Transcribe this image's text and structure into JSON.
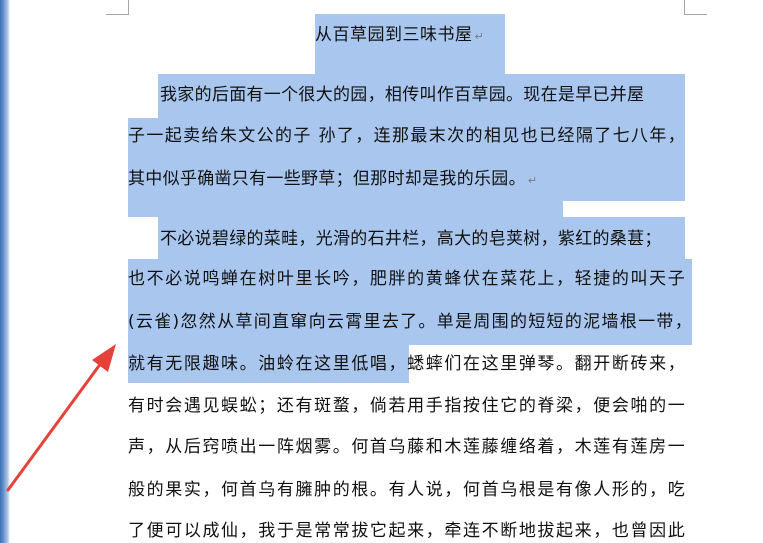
{
  "document": {
    "title": "从百草园到三味书屋",
    "paragraph_mark": "↵",
    "lines": [
      "我家的后面有一个很大的园，相传叫作百草园。现在是早已并屋",
      "子一起卖给朱文公的子 孙了，连那最末次的相见也已经隔了七八年，",
      "其中似乎确凿只有一些野草；但那时却是我的乐园。",
      "不必说碧绿的菜畦，光滑的石井栏，高大的皂荚树，紫红的桑葚；",
      "也不必说鸣蝉在树叶里长吟，肥胖的黄蜂伏在菜花上，轻捷的叫天子",
      "(云雀)忽然从草间直窜向云霄里去了。单是周围的短短的泥墙根一带，",
      "就有无限趣味。油蛉在这里低唱，蟋蟀们在这里弹琴。翻开断砖来，",
      "有时会遇见蜈蚣；还有斑蝥，倘若用手指按住它的脊梁，便会啪的一",
      "声，从后窍喷出一阵烟雾。何首乌藤和木莲藤缠络着，木莲有莲房一",
      "般的果实，何首乌有臃肿的根。有人说，何首乌根是有像人形的，吃",
      "了便可以成仙，我于是常常拔它起来，牵连不断地拔起来，也曾因此"
    ]
  },
  "colors": {
    "selection": "#a9c7ee",
    "annotation_arrow": "#e5423a",
    "text": "#111111"
  }
}
